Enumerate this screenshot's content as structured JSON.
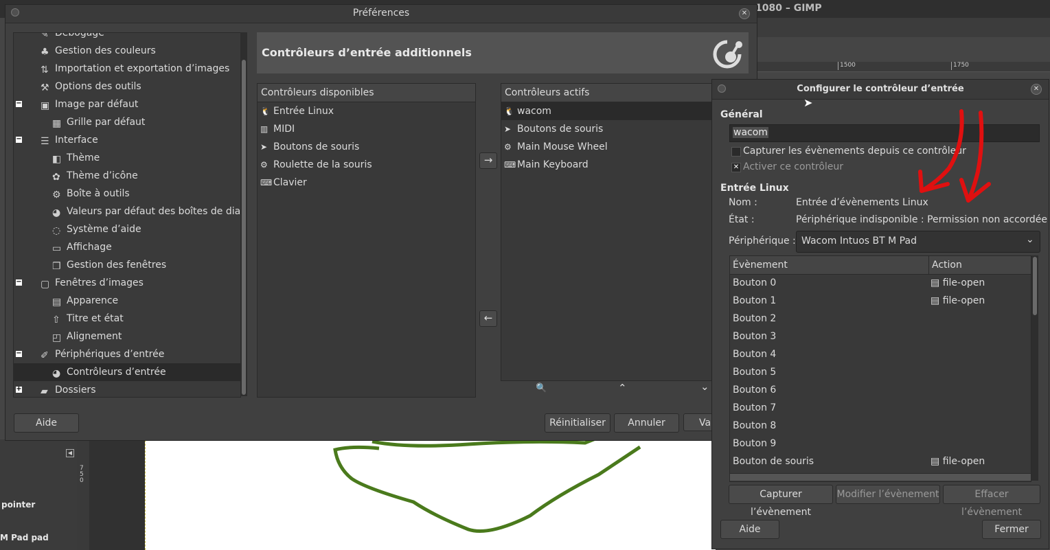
{
  "background": {
    "window_title": "1080 – GIMP",
    "ruler_ticks": [
      "1500",
      "1750"
    ],
    "side_labels": [
      "pointer",
      "M Pad pad"
    ],
    "vruler_label": "750"
  },
  "preferences": {
    "title": "Préférences",
    "tree": [
      {
        "label": "Débogage",
        "level": 0,
        "icon": "bug-icon"
      },
      {
        "label": "Gestion des couleurs",
        "level": 0,
        "icon": "color-icon"
      },
      {
        "label": "Importation et exportation d’images",
        "level": 0,
        "icon": "import-icon"
      },
      {
        "label": "Options des outils",
        "level": 0,
        "icon": "tool-options-icon"
      },
      {
        "label": "Image par défaut",
        "level": 0,
        "icon": "image-icon",
        "expander": "−"
      },
      {
        "label": "Grille par défaut",
        "level": 1,
        "icon": "grid-icon"
      },
      {
        "label": "Interface",
        "level": 0,
        "icon": "interface-icon",
        "expander": "−"
      },
      {
        "label": "Thème",
        "level": 1,
        "icon": "theme-icon"
      },
      {
        "label": "Thème d’icône",
        "level": 1,
        "icon": "icon-theme-icon"
      },
      {
        "label": "Boîte à outils",
        "level": 1,
        "icon": "toolbox-icon"
      },
      {
        "label": "Valeurs par défaut des boîtes de dialogue",
        "level": 1,
        "icon": "dialog-defaults-icon"
      },
      {
        "label": "Système d’aide",
        "level": 1,
        "icon": "help-icon"
      },
      {
        "label": "Affichage",
        "level": 1,
        "icon": "display-icon"
      },
      {
        "label": "Gestion des fenêtres",
        "level": 1,
        "icon": "windows-icon"
      },
      {
        "label": "Fenêtres d’images",
        "level": 0,
        "icon": "image-windows-icon",
        "expander": "−"
      },
      {
        "label": "Apparence",
        "level": 1,
        "icon": "appearance-icon"
      },
      {
        "label": "Titre et état",
        "level": 1,
        "icon": "title-icon"
      },
      {
        "label": "Alignement",
        "level": 1,
        "icon": "snap-icon"
      },
      {
        "label": "Périphériques d’entrée",
        "level": 0,
        "icon": "input-devices-icon",
        "expander": "−"
      },
      {
        "label": "Contrôleurs d’entrée",
        "level": 1,
        "icon": "controller-icon",
        "selected": true
      },
      {
        "label": "Dossiers",
        "level": 0,
        "icon": "folders-icon",
        "expander": "+"
      }
    ],
    "header_title": "Contrôleurs d’entrée additionnels",
    "available": {
      "header": "Contrôleurs disponibles",
      "items": [
        {
          "label": "Entrée Linux",
          "icon": "linux-icon",
          "glyph": "🐧"
        },
        {
          "label": "MIDI",
          "icon": "midi-icon",
          "glyph": "▥"
        },
        {
          "label": "Boutons de souris",
          "icon": "pointer-icon",
          "glyph": "➤"
        },
        {
          "label": "Roulette de la souris",
          "icon": "wheel-icon",
          "glyph": "⚙"
        },
        {
          "label": "Clavier",
          "icon": "keyboard-icon",
          "glyph": "⌨"
        }
      ]
    },
    "active": {
      "header": "Contrôleurs actifs",
      "items": [
        {
          "label": "wacom",
          "icon": "linux-icon",
          "glyph": "🐧",
          "selected": true
        },
        {
          "label": "Boutons de souris",
          "icon": "pointer-icon",
          "glyph": "➤"
        },
        {
          "label": "Main Mouse Wheel",
          "icon": "wheel-icon",
          "glyph": "⚙"
        },
        {
          "label": "Main Keyboard",
          "icon": "keyboard-icon",
          "glyph": "⌨"
        }
      ]
    },
    "buttons": {
      "help": "Aide",
      "reset": "Réinitialiser",
      "cancel": "Annuler",
      "ok": "Va"
    }
  },
  "configure": {
    "title": "Configurer le contrôleur d’entrée",
    "general_heading": "Général",
    "name_value": "wacom",
    "capture_label": "Capturer les évènements depuis ce contrôleur",
    "capture_checked": false,
    "enable_label": "Activer ce contrôleur",
    "enable_checked": true,
    "linux_heading": "Entrée Linux",
    "name_label": "Nom :",
    "name_info": "Entrée d’évènements Linux",
    "state_label": "État :",
    "state_info": "Périphérique indisponible : Permission non accordée",
    "device_label": "Périphérique :",
    "device_value": "Wacom Intuos BT M Pad",
    "table": {
      "col_event": "Évènement",
      "col_action": "Action",
      "rows": [
        {
          "event": "Bouton 0",
          "action": "file-open"
        },
        {
          "event": "Bouton 1",
          "action": "file-open"
        },
        {
          "event": "Bouton 2",
          "action": ""
        },
        {
          "event": "Bouton 3",
          "action": ""
        },
        {
          "event": "Bouton 4",
          "action": ""
        },
        {
          "event": "Bouton 5",
          "action": ""
        },
        {
          "event": "Bouton 6",
          "action": ""
        },
        {
          "event": "Bouton 7",
          "action": ""
        },
        {
          "event": "Bouton 8",
          "action": ""
        },
        {
          "event": "Bouton 9",
          "action": ""
        },
        {
          "event": "Bouton de souris",
          "action": "file-open"
        }
      ]
    },
    "btn_capture": "Capturer l’évènement",
    "btn_modify": "Modifier l’évènement",
    "btn_clear": "Effacer l’évènement",
    "btn_help": "Aide",
    "btn_close": "Fermer"
  },
  "colors": {
    "annotation_red": "#e01010",
    "stroke_green": "#4a7a1c"
  }
}
